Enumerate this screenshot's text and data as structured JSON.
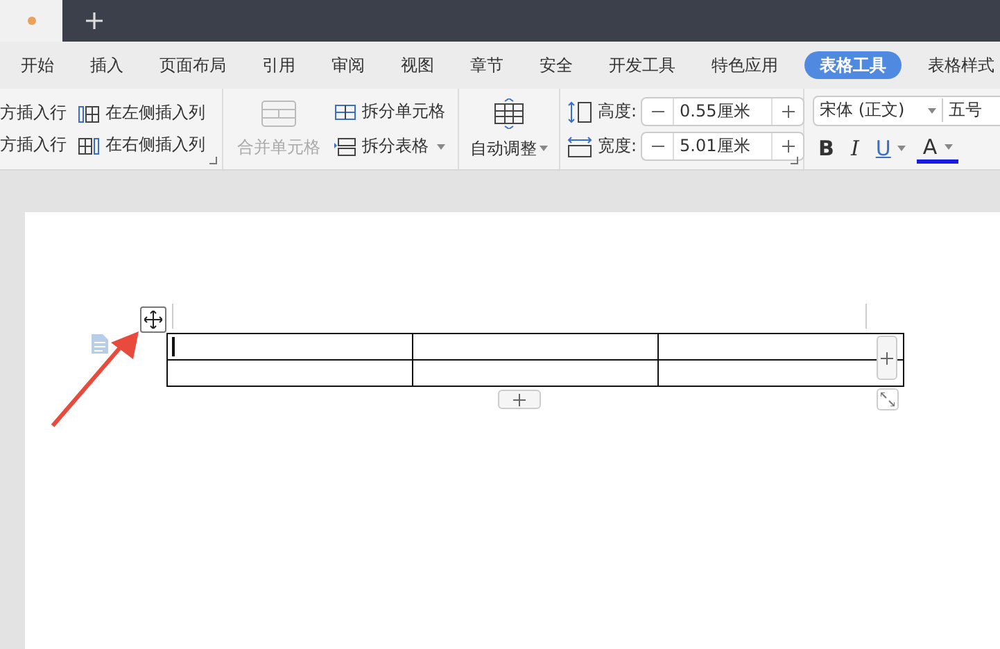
{
  "document_tab": {
    "unsaved": true
  },
  "menu_tabs": [
    {
      "label": "开始",
      "selected": false
    },
    {
      "label": "插入",
      "selected": false
    },
    {
      "label": "页面布局",
      "selected": false
    },
    {
      "label": "引用",
      "selected": false
    },
    {
      "label": "审阅",
      "selected": false
    },
    {
      "label": "视图",
      "selected": false
    },
    {
      "label": "章节",
      "selected": false
    },
    {
      "label": "安全",
      "selected": false
    },
    {
      "label": "开发工具",
      "selected": false
    },
    {
      "label": "特色应用",
      "selected": false
    },
    {
      "label": "表格工具",
      "selected": true
    },
    {
      "label": "表格样式",
      "selected": false
    }
  ],
  "insert_group": {
    "items": [
      {
        "kind": "row_above",
        "label": "方插入行"
      },
      {
        "kind": "col_left",
        "label": "在左侧插入列"
      },
      {
        "kind": "row_below",
        "label": "方插入行"
      },
      {
        "kind": "col_right",
        "label": "在右侧插入列"
      }
    ]
  },
  "merge_group": {
    "merge": {
      "label": "合并单元格",
      "disabled": true
    },
    "split_items": [
      {
        "kind": "split_cell",
        "label": "拆分单元格",
        "dropdown": false
      },
      {
        "kind": "split_table",
        "label": "拆分表格",
        "dropdown": true
      }
    ]
  },
  "auto_fit": {
    "label": "自动调整",
    "dropdown": true
  },
  "size_group": [
    {
      "kind": "height",
      "label": "高度:",
      "value": "0.55厘米"
    },
    {
      "kind": "width",
      "label": "宽度:",
      "value": "5.01厘米"
    }
  ],
  "font_group": {
    "font": "宋体 (正文)",
    "size": "五号",
    "format_buttons": [
      {
        "kind": "bold",
        "label": "B",
        "dropdown": false
      },
      {
        "kind": "italic",
        "label": "I",
        "dropdown": false
      },
      {
        "kind": "underline",
        "label": "U",
        "dropdown": true
      },
      {
        "kind": "color",
        "label": "A",
        "dropdown": true
      }
    ]
  },
  "table": {
    "rows": [
      {
        "cells": [
          {
            "cursor": true
          },
          {
            "cursor": false
          },
          {
            "cursor": false
          }
        ]
      },
      {
        "cells": [
          {
            "cursor": false
          },
          {
            "cursor": false
          },
          {
            "cursor": false
          }
        ]
      }
    ]
  }
}
